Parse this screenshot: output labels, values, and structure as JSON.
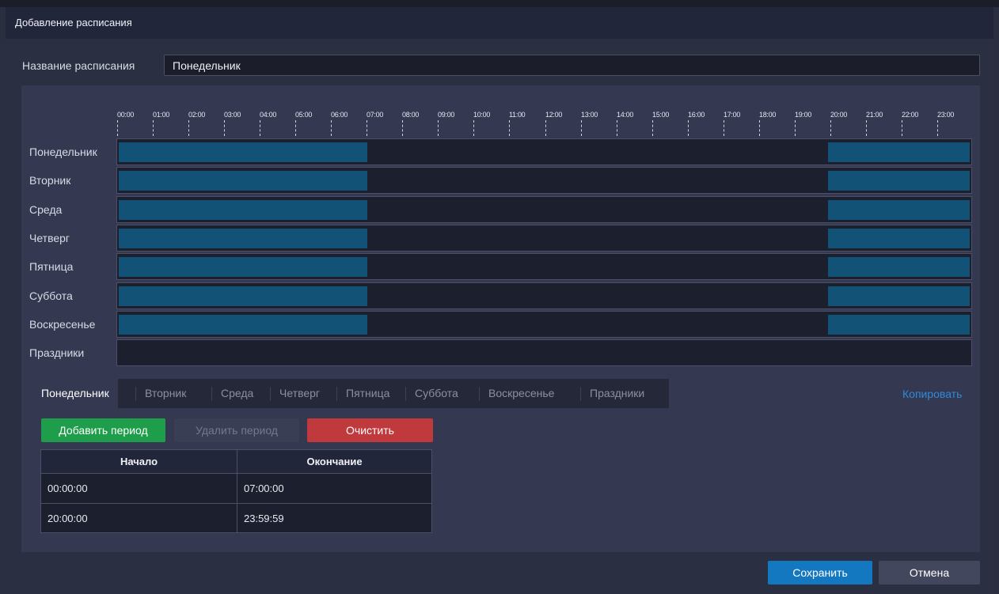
{
  "dialog": {
    "title": "Добавление расписания",
    "name_label": "Название расписания",
    "name_value": "Понедельник"
  },
  "timeline": {
    "hours": [
      "00:00",
      "01:00",
      "02:00",
      "03:00",
      "04:00",
      "05:00",
      "06:00",
      "07:00",
      "08:00",
      "09:00",
      "10:00",
      "11:00",
      "12:00",
      "13:00",
      "14:00",
      "15:00",
      "16:00",
      "17:00",
      "18:00",
      "19:00",
      "20:00",
      "21:00",
      "22:00",
      "23:00"
    ],
    "days": [
      {
        "label": "Понедельник",
        "periods": [
          [
            "00:00:00",
            "07:00:00"
          ],
          [
            "20:00:00",
            "23:59:59"
          ]
        ]
      },
      {
        "label": "Вторник",
        "periods": [
          [
            "00:00:00",
            "07:00:00"
          ],
          [
            "20:00:00",
            "23:59:59"
          ]
        ]
      },
      {
        "label": "Среда",
        "periods": [
          [
            "00:00:00",
            "07:00:00"
          ],
          [
            "20:00:00",
            "23:59:59"
          ]
        ]
      },
      {
        "label": "Четверг",
        "periods": [
          [
            "00:00:00",
            "07:00:00"
          ],
          [
            "20:00:00",
            "23:59:59"
          ]
        ]
      },
      {
        "label": "Пятница",
        "periods": [
          [
            "00:00:00",
            "07:00:00"
          ],
          [
            "20:00:00",
            "23:59:59"
          ]
        ]
      },
      {
        "label": "Суббота",
        "periods": [
          [
            "00:00:00",
            "07:00:00"
          ],
          [
            "20:00:00",
            "23:59:59"
          ]
        ]
      },
      {
        "label": "Воскресенье",
        "periods": [
          [
            "00:00:00",
            "07:00:00"
          ],
          [
            "20:00:00",
            "23:59:59"
          ]
        ]
      },
      {
        "label": "Праздники",
        "periods": []
      }
    ],
    "segment_color": "#125277"
  },
  "tabs": {
    "items": [
      "Понедельник",
      "Вторник",
      "Среда",
      "Четверг",
      "Пятница",
      "Суббота",
      "Воскресенье",
      "Праздники"
    ],
    "active": "Понедельник",
    "copy_label": "Копировать"
  },
  "actions": {
    "add_label": "Добавить период",
    "delete_label": "Удалить период",
    "clear_label": "Очистить"
  },
  "periods_table": {
    "headers": [
      "Начало",
      "Окончание"
    ],
    "rows": [
      [
        "00:00:00",
        "07:00:00"
      ],
      [
        "20:00:00",
        "23:59:59"
      ]
    ]
  },
  "footer": {
    "save_label": "Сохранить",
    "cancel_label": "Отмена"
  },
  "colors": {
    "accent": "#1478c0",
    "add": "#1e9e4a",
    "clear": "#c0393c",
    "link": "#2e8bd8"
  }
}
